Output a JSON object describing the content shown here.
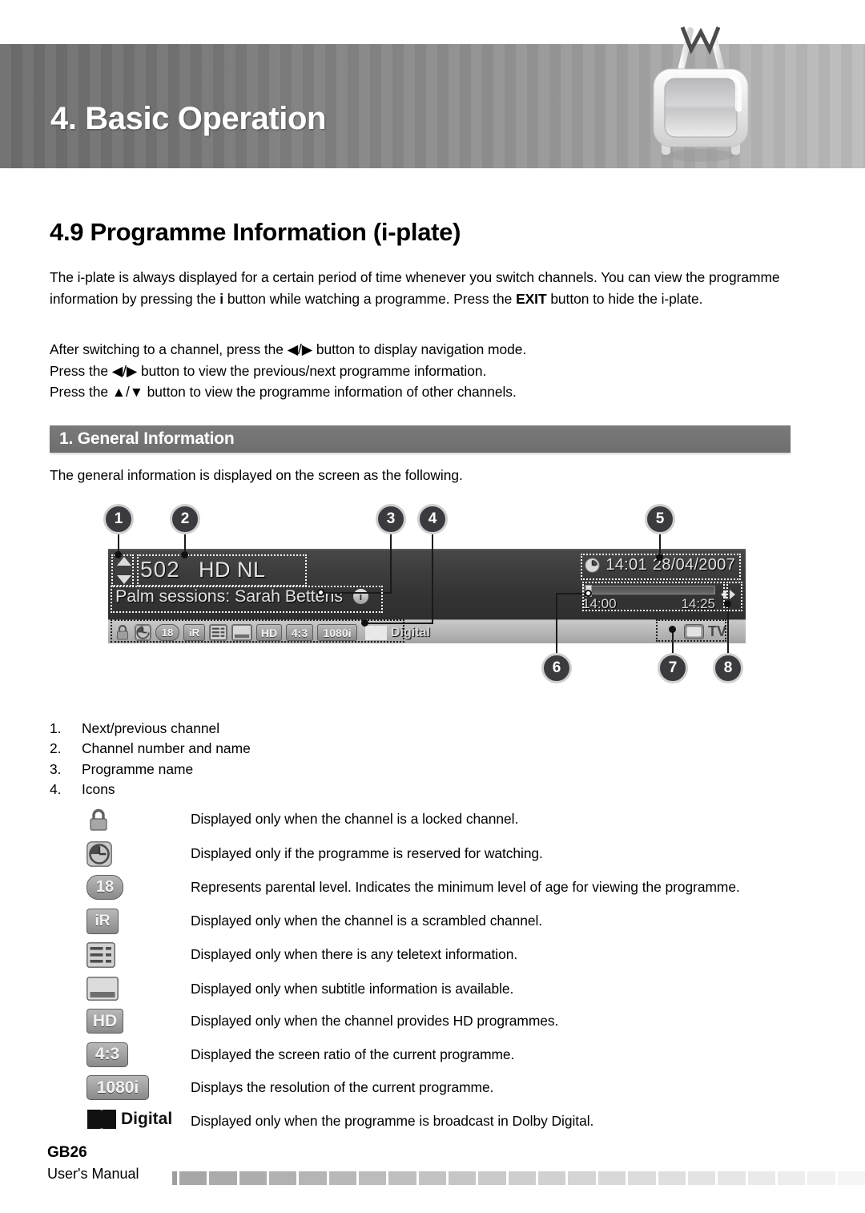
{
  "header": {
    "chapter_title": "4. Basic Operation",
    "mascot_icon": "tv-set-icon"
  },
  "section": {
    "title": "4.9 Programme Information (i-plate)",
    "paragraph_1_a": "The i-plate is always displayed for a certain period of time whenever you switch channels. You can view the programme information by pressing the ",
    "paragraph_1_bold_1": "i",
    "paragraph_1_b": " button while watching a programme. Press the ",
    "paragraph_1_bold_2": "EXIT",
    "paragraph_1_c": " button to hide the i-plate.",
    "paragraph_2_line_1": "After switching to a channel, press the ◀/▶ button to display navigation mode.",
    "paragraph_2_line_2": "Press the ◀/▶ button to view the previous/next programme information.",
    "paragraph_2_line_3": "Press the ▲/▼ button to view the programme information of other channels."
  },
  "subsection": {
    "bar_title": "1. General Information",
    "note": "The general information is displayed on the screen as the following."
  },
  "iplate": {
    "channel_number": "502",
    "channel_name": "HD NL",
    "programme_name": "Palm sessions: Sarah Bettens",
    "info_badge": "i",
    "clock_time": "14:01",
    "clock_date": "28/04/2007",
    "progress_start": "14:00",
    "progress_end": "14:25",
    "mode_label": "TV",
    "clock_icon": "clock-icon",
    "tv_icon": "tv-screen-icon",
    "updown_icon": "up-down-arrows-icon",
    "leftright_icon": "left-right-arrows-icon",
    "icons": [
      {
        "name": "lock-icon",
        "label": ""
      },
      {
        "name": "clock-reserve-icon",
        "label": ""
      },
      {
        "name": "parental-18-icon",
        "label": "18"
      },
      {
        "name": "scrambled-ir-icon",
        "label": "iR"
      },
      {
        "name": "teletext-icon",
        "label": ""
      },
      {
        "name": "subtitle-icon",
        "label": ""
      },
      {
        "name": "hd-icon",
        "label": "HD"
      },
      {
        "name": "aspect-ratio-icon",
        "label": "4:3"
      },
      {
        "name": "resolution-1080i-icon",
        "label": "1080i"
      },
      {
        "name": "dolby-digital-icon",
        "label": "Digital"
      }
    ],
    "callouts": [
      "1",
      "2",
      "3",
      "4",
      "5",
      "6",
      "7",
      "8"
    ]
  },
  "numbered_list": [
    {
      "n": "1.",
      "text": "Next/previous channel"
    },
    {
      "n": "2.",
      "text": "Channel number and name"
    },
    {
      "n": "3.",
      "text": "Programme name"
    },
    {
      "n": "4.",
      "text": "Icons"
    }
  ],
  "icon_legend": [
    {
      "icon": "lock-icon",
      "label": "",
      "description": "Displayed only when the channel is a locked channel."
    },
    {
      "icon": "clock-reserve-icon",
      "label": "",
      "description": "Displayed only if the programme is reserved for watching."
    },
    {
      "icon": "parental-18-icon",
      "label": "18",
      "description": "Represents parental level. Indicates the minimum level of age for viewing the programme."
    },
    {
      "icon": "scrambled-ir-icon",
      "label": "iR",
      "description": "Displayed only when the channel is a scrambled channel."
    },
    {
      "icon": "teletext-icon",
      "label": "",
      "description": "Displayed only when there is any teletext information."
    },
    {
      "icon": "subtitle-icon",
      "label": "",
      "description": "Displayed only when subtitle information is available."
    },
    {
      "icon": "hd-icon",
      "label": "HD",
      "description": "Displayed only when the channel provides HD programmes."
    },
    {
      "icon": "aspect-ratio-icon",
      "label": "4:3",
      "description": "Displayed the screen ratio of the current programme."
    },
    {
      "icon": "resolution-1080i-icon",
      "label": "1080i",
      "description": "Displays the resolution of the current programme."
    },
    {
      "icon": "dolby-digital-icon",
      "label": "Digital",
      "description": "Displayed only when the programme is broadcast in Dolby Digital."
    }
  ],
  "footer": {
    "page_code": "GB26",
    "manual_label": "User's Manual"
  },
  "colors": {
    "header_band_dark": "#6e6e6e",
    "header_band_light": "#bcbcbc",
    "subhead_bar": "#727272",
    "callout_fill": "#3a3a3f",
    "callout_ring": "#cfcfcf",
    "iplate_top": "#3d3d3d",
    "iplate_bottom": "#b4b4b4"
  }
}
